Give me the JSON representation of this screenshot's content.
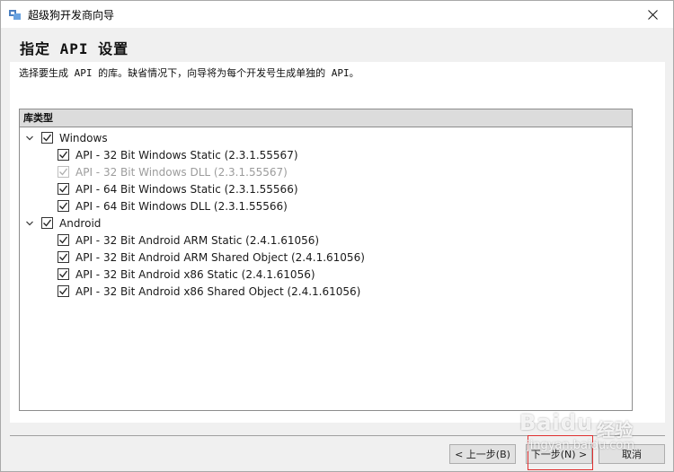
{
  "window": {
    "title": "超级狗开发商向导"
  },
  "header": {
    "heading": "指定 API 设置",
    "description": "选择要生成 API 的库。缺省情况下，向导将为每个开发号生成单独的 API。"
  },
  "tree": {
    "column_header": "库类型",
    "groups": [
      {
        "label": "Windows",
        "checked": true,
        "expanded": true,
        "items": [
          {
            "label": "API - 32 Bit Windows Static (2.3.1.55567)",
            "checked": true,
            "disabled": false
          },
          {
            "label": "API - 32 Bit Windows DLL (2.3.1.55567)",
            "checked": true,
            "disabled": true
          },
          {
            "label": "API - 64 Bit Windows Static (2.3.1.55566)",
            "checked": true,
            "disabled": false
          },
          {
            "label": "API - 64 Bit Windows DLL (2.3.1.55566)",
            "checked": true,
            "disabled": false
          }
        ]
      },
      {
        "label": "Android",
        "checked": true,
        "expanded": true,
        "items": [
          {
            "label": "API - 32 Bit Android ARM Static (2.4.1.61056)",
            "checked": true,
            "disabled": false
          },
          {
            "label": "API - 32 Bit Android ARM Shared Object (2.4.1.61056)",
            "checked": true,
            "disabled": false
          },
          {
            "label": "API - 32 Bit Android x86 Static (2.4.1.61056)",
            "checked": true,
            "disabled": false
          },
          {
            "label": "API - 32 Bit Android x86 Shared Object (2.4.1.61056)",
            "checked": true,
            "disabled": false
          }
        ]
      }
    ]
  },
  "buttons": {
    "back": "< 上一步(B)",
    "next": "下一步(N) >",
    "cancel": "取消"
  },
  "watermark": {
    "logo": "Baidu",
    "jingyan": "经验",
    "url": "jingyan.baidu.com"
  }
}
